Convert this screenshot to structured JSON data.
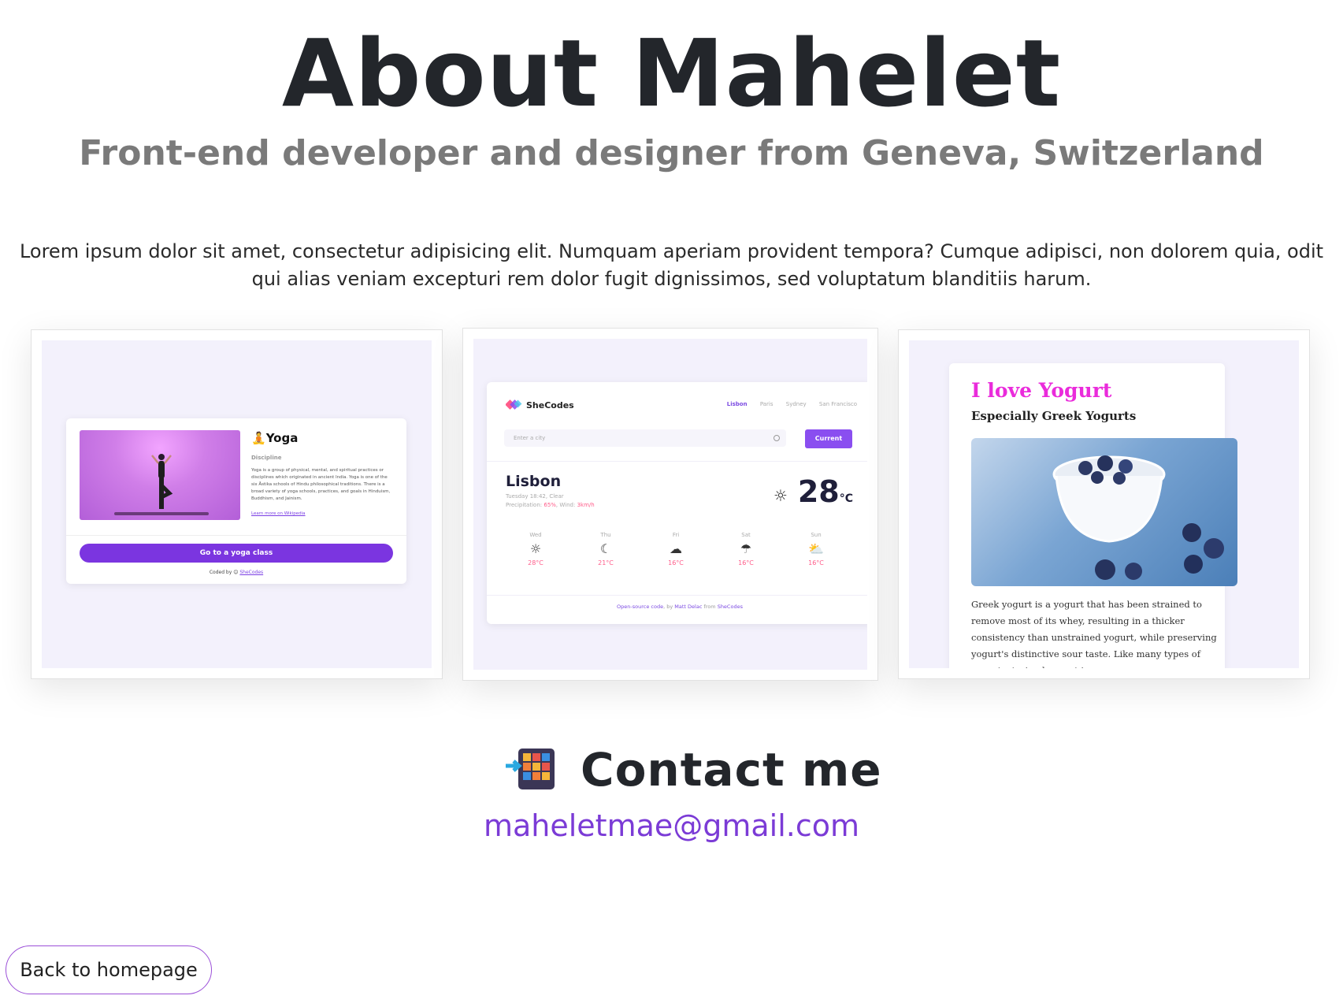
{
  "header": {
    "title": "About Mahelet",
    "subtitle": "Front-end developer and designer from Geneva, Switzerland"
  },
  "intro": "Lorem ipsum dolor sit amet, consectetur adipisicing elit. Numquam aperiam provident tempora? Cumque adipisci, non dolorem quia, odit qui alias veniam excepturi rem dolor fugit dignissimos, sed voluptatum blanditiis harum.",
  "projects": {
    "yoga": {
      "title": "Yoga",
      "discipline": "Discipline",
      "description": "Yoga is a group of physical, mental, and spiritual practices or disciplines which originated in ancient India. Yoga is one of the six Āstika schools of Hindu philosophical traditions. There is a broad variety of yoga schools, practices, and goals in Hinduism, Buddhism, and Jainism.",
      "link": "Learn more on Wikipedia",
      "button": "Go to a yoga class",
      "coded_prefix": "Coded by",
      "coded_link": "SheCodes"
    },
    "weather": {
      "brand": "SheCodes",
      "tabs": [
        "Lisbon",
        "Paris",
        "Sydney",
        "San Francisco"
      ],
      "search_placeholder": "Enter a city",
      "current_button": "Current",
      "city": "Lisbon",
      "datetime": "Tuesday 18:42, Clear",
      "precip_label": "Precipitation:",
      "precip_value": "65%",
      "wind_label": ", Wind:",
      "wind_value": "3km/h",
      "temperature": "28",
      "unit": "°C",
      "forecast": [
        {
          "day": "Wed",
          "icon": "☼",
          "temp": "28°C"
        },
        {
          "day": "Thu",
          "icon": "☾",
          "temp": "21°C"
        },
        {
          "day": "Fri",
          "icon": "☁",
          "temp": "16°C"
        },
        {
          "day": "Sat",
          "icon": "☂",
          "temp": "16°C"
        },
        {
          "day": "Sun",
          "icon": "⛅",
          "temp": "16°C"
        }
      ],
      "footer_link1": "Open-source code",
      "footer_mid": ", by",
      "footer_link2": "Matt Delac",
      "footer_from": "from",
      "footer_link3": "SheCodes"
    },
    "yogurt": {
      "title": "I love Yogurt",
      "subtitle": "Especially Greek Yogurts",
      "text": "Greek yogurt is a yogurt that has been strained to remove most of its whey, resulting in a thicker consistency than unstrained yogurt, while preserving yogurt's distinctive sour taste. Like many types of yogurt, strained yogurt is"
    }
  },
  "contact": {
    "heading": "Contact me",
    "email": "maheletmae@gmail.com"
  },
  "footer": {
    "back_label": "Back to homepage"
  },
  "colors": {
    "accent": "#7b3bd6",
    "button_border": "#9b4fd8",
    "yogurt_title": "#ea2bdb"
  }
}
